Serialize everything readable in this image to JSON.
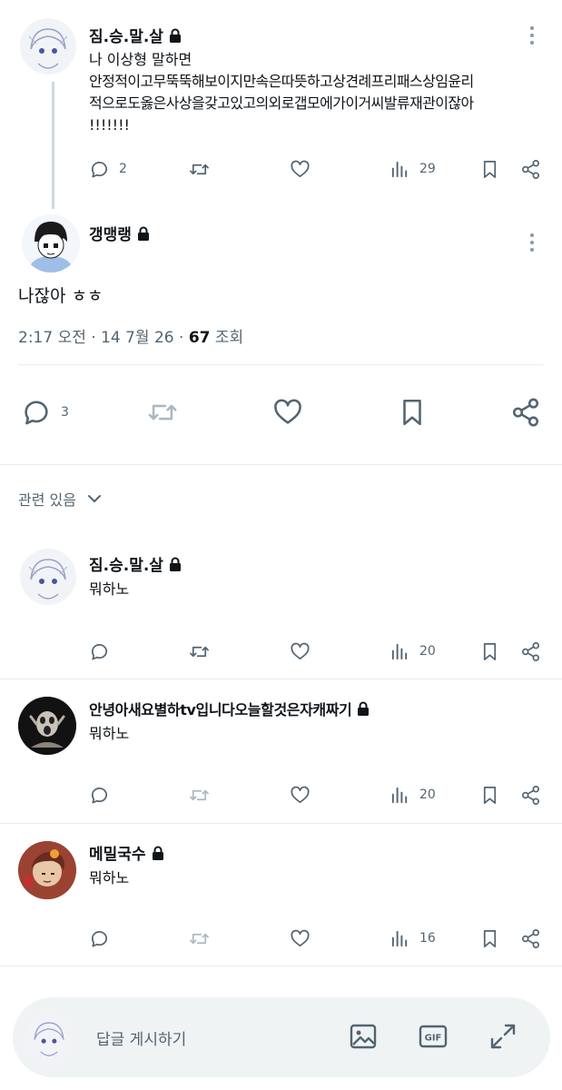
{
  "main_post": {
    "author": "짐.승.말.살",
    "lines": [
      "나 이상형 말하면",
      "안정적이고무뚝뚝해보이지만속은따뜻하고상견례프리패스상임윤리",
      "적으로도옳은사상을갖고있고의외로갭모에가이거씨발류재관이잖아",
      "!!!!!!!"
    ],
    "replies": "2",
    "views": "29"
  },
  "focused_post": {
    "author": "갱맹랭",
    "text": "나잖아 ㅎㅎ",
    "time": "2:17 오전",
    "date": "14 7월 26",
    "view_count": "67",
    "view_label": "조회",
    "replies": "3"
  },
  "related": {
    "label": "관련 있음"
  },
  "replies": [
    {
      "author": "짐.승.말.살",
      "text": "뭐하노",
      "views": "20"
    },
    {
      "author": "안녕아새요별하tv입니다오늘할것은자캐짜기",
      "text": "뭐하노",
      "views": "20"
    },
    {
      "author": "메밀국수",
      "text": "뭐하노",
      "views": "16"
    }
  ],
  "composer": {
    "placeholder": "답글 게시하기",
    "gif_label": "GIF"
  },
  "colors": {
    "text": "#0f1419",
    "secondary": "#536471",
    "divider": "#e6ecf0",
    "composer_bg": "#eff3f4"
  },
  "icons": [
    "lock-icon",
    "more-icon",
    "reply-icon",
    "retweet-icon",
    "like-icon",
    "views-icon",
    "bookmark-icon",
    "share-icon",
    "chevron-down-icon",
    "image-icon",
    "gif-icon",
    "expand-icon"
  ]
}
